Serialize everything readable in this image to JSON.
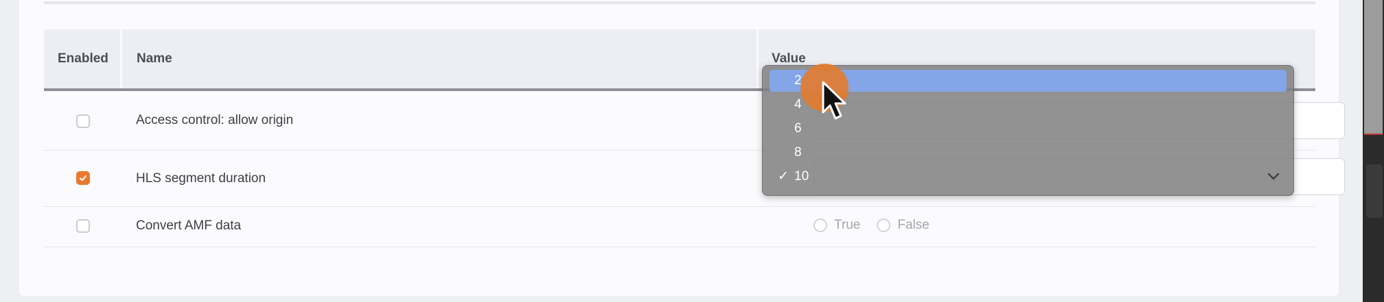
{
  "table": {
    "headers": {
      "enabled": "Enabled",
      "name": "Name",
      "value": "Value"
    },
    "rows": [
      {
        "enabled": false,
        "name": "Access control: allow origin",
        "value": ""
      },
      {
        "enabled": true,
        "name": "HLS segment duration",
        "value": "10"
      },
      {
        "enabled": false,
        "name": "Convert AMF data",
        "value": ""
      }
    ],
    "radio_options": [
      "True",
      "False"
    ]
  },
  "dropdown": {
    "options": [
      "2",
      "4",
      "6",
      "8",
      "10"
    ],
    "highlighted": "2",
    "selected": "10",
    "check_mark": "✓"
  },
  "colors": {
    "accent": "#ea7a2e",
    "highlight": "#84a5e8"
  },
  "icons": {
    "checkbox_checked": "check-icon",
    "select_arrow": "chevron-down-icon",
    "cursor": "pointer-icon"
  }
}
